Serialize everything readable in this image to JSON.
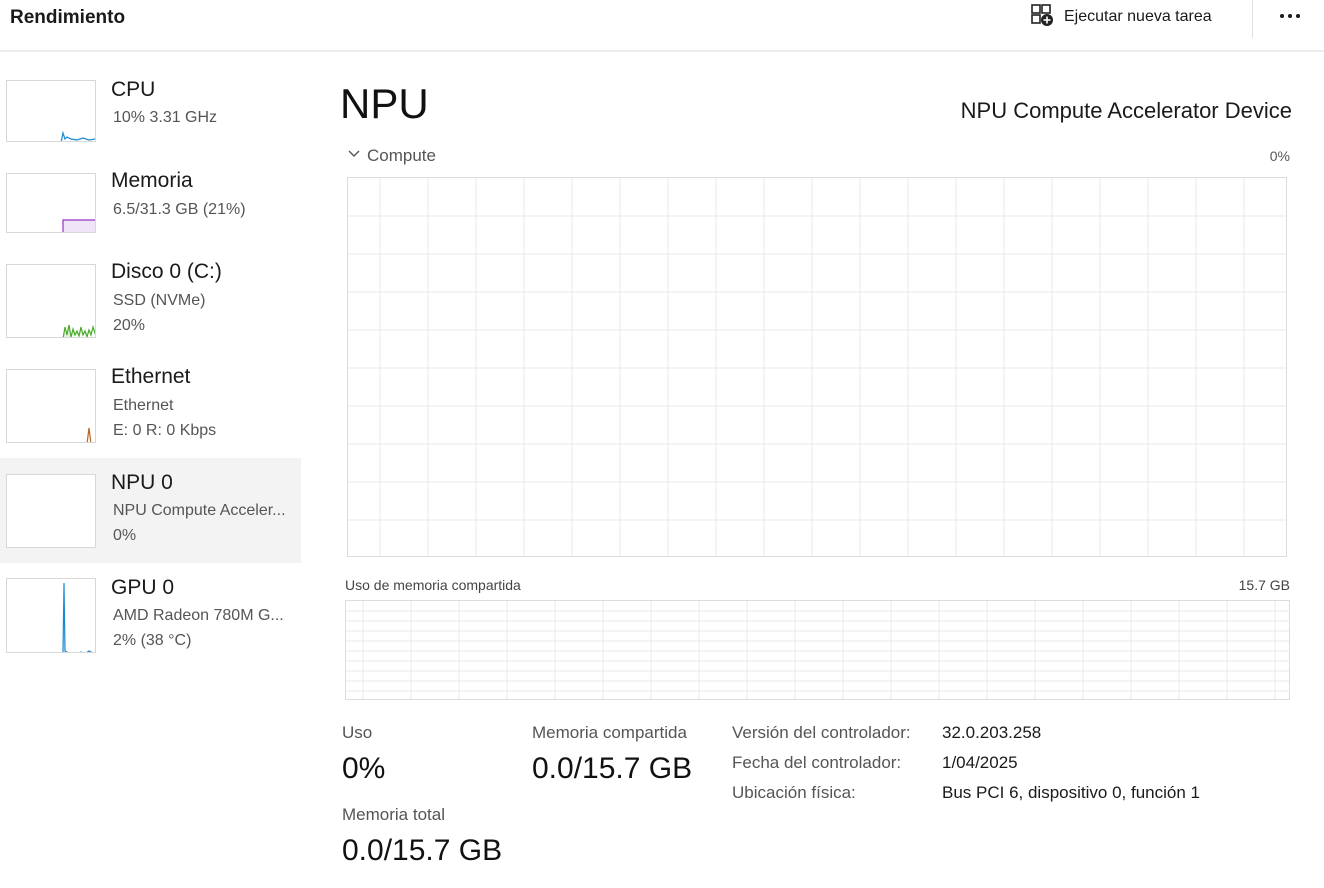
{
  "header": {
    "title": "Rendimiento",
    "run_task_label": "Ejecutar nueva tarea",
    "run_task_icon": "new-task-icon",
    "more_icon": "more-icon"
  },
  "sidebar": {
    "items": [
      {
        "name": "CPU",
        "line1": "10%  3.31 GHz",
        "line2": "",
        "color": "#1a8ad4",
        "selected": false
      },
      {
        "name": "Memoria",
        "line1": "6.5/31.3 GB (21%)",
        "line2": "",
        "color": "#9b30c8",
        "selected": false
      },
      {
        "name": "Disco 0 (C:)",
        "line1": "SSD (NVMe)",
        "line2": "20%",
        "color": "#4caa2c",
        "selected": false
      },
      {
        "name": "Ethernet",
        "line1": "Ethernet",
        "line2": "E: 0  R: 0 Kbps",
        "color": "#b5651d",
        "selected": false
      },
      {
        "name": "NPU 0",
        "line1": "NPU Compute Acceler...",
        "line2": "0%",
        "color": "#1a8ad4",
        "selected": true
      },
      {
        "name": "GPU 0",
        "line1": "AMD Radeon 780M G...",
        "line2": "2%  (38 °C)",
        "color": "#1a8ad4",
        "selected": false
      }
    ]
  },
  "main": {
    "title": "NPU",
    "device_name": "NPU Compute Accelerator Device",
    "compute": {
      "label": "Compute",
      "max": "0%",
      "toggle_icon": "chevron-down-icon"
    },
    "shared_memory_graph": {
      "label": "Uso de memoria compartida",
      "max": "15.7 GB"
    },
    "stats": {
      "uso_label": "Uso",
      "uso_value": "0%",
      "mem_compartida_label": "Memoria compartida",
      "mem_compartida_value": "0.0/15.7 GB",
      "mem_total_label": "Memoria total",
      "mem_total_value": "0.0/15.7 GB"
    },
    "info": {
      "driver_version_label": "Versión del controlador:",
      "driver_version": "32.0.203.258",
      "driver_date_label": "Fecha del controlador:",
      "driver_date": "1/04/2025",
      "location_label": "Ubicación física:",
      "location": "Bus PCI 6, dispositivo 0, función 1"
    }
  },
  "colors": {
    "accent_blue": "#1a8ad4",
    "memory_purple": "#9b30c8",
    "disk_green": "#4caa2c",
    "ethernet_brown": "#b5651d",
    "grid_line": "#e8e8e8",
    "selected_bg": "#f3f3f3"
  }
}
